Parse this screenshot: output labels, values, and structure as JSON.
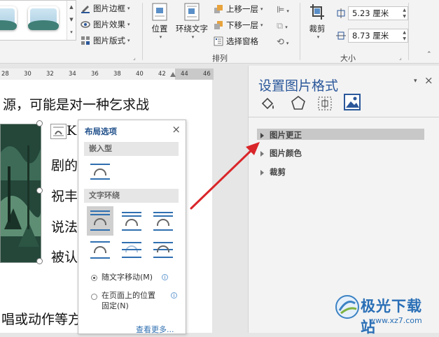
{
  "ribbon": {
    "picture_styles": {
      "border_label": "图片边框",
      "effects_label": "图片效果",
      "layout_label": "图片版式"
    },
    "arrange": {
      "position_label": "位置",
      "wrap_text_label": "环绕文字",
      "bring_forward_label": "上移一层",
      "send_backward_label": "下移一层",
      "selection_pane_label": "选择窗格",
      "group_label": "排列"
    },
    "size": {
      "crop_label": "裁剪",
      "height_value": "5.23 厘米",
      "width_value": "8.73 厘米",
      "group_label": "大小"
    }
  },
  "ruler": {
    "ticks": [
      "28",
      "30",
      "32",
      "34",
      "36",
      "38",
      "40",
      "42",
      "44",
      "46"
    ]
  },
  "document": {
    "lines": [
      "源，可能是对一种乞求战",
      "剧的",
      "祝丰",
      "说法",
      "被认",
      "唱或动作等方"
    ],
    "first_glyph": "K"
  },
  "layout_popup": {
    "title": "布局选项",
    "inline_section": "嵌入型",
    "wrap_section": "文字环绕",
    "move_with_text": "随文字移动(M)",
    "fix_position_line1": "在页面上的位置",
    "fix_position_line2": "固定(N)",
    "see_more": "查看更多..."
  },
  "format_panel": {
    "title": "设置图片格式",
    "sections": [
      "图片更正",
      "图片颜色",
      "裁剪"
    ]
  },
  "watermark": {
    "name": "极光下载站",
    "url": "www.xz7.com"
  },
  "colors": {
    "accent": "#2b579a",
    "arrow": "#d9262a"
  }
}
